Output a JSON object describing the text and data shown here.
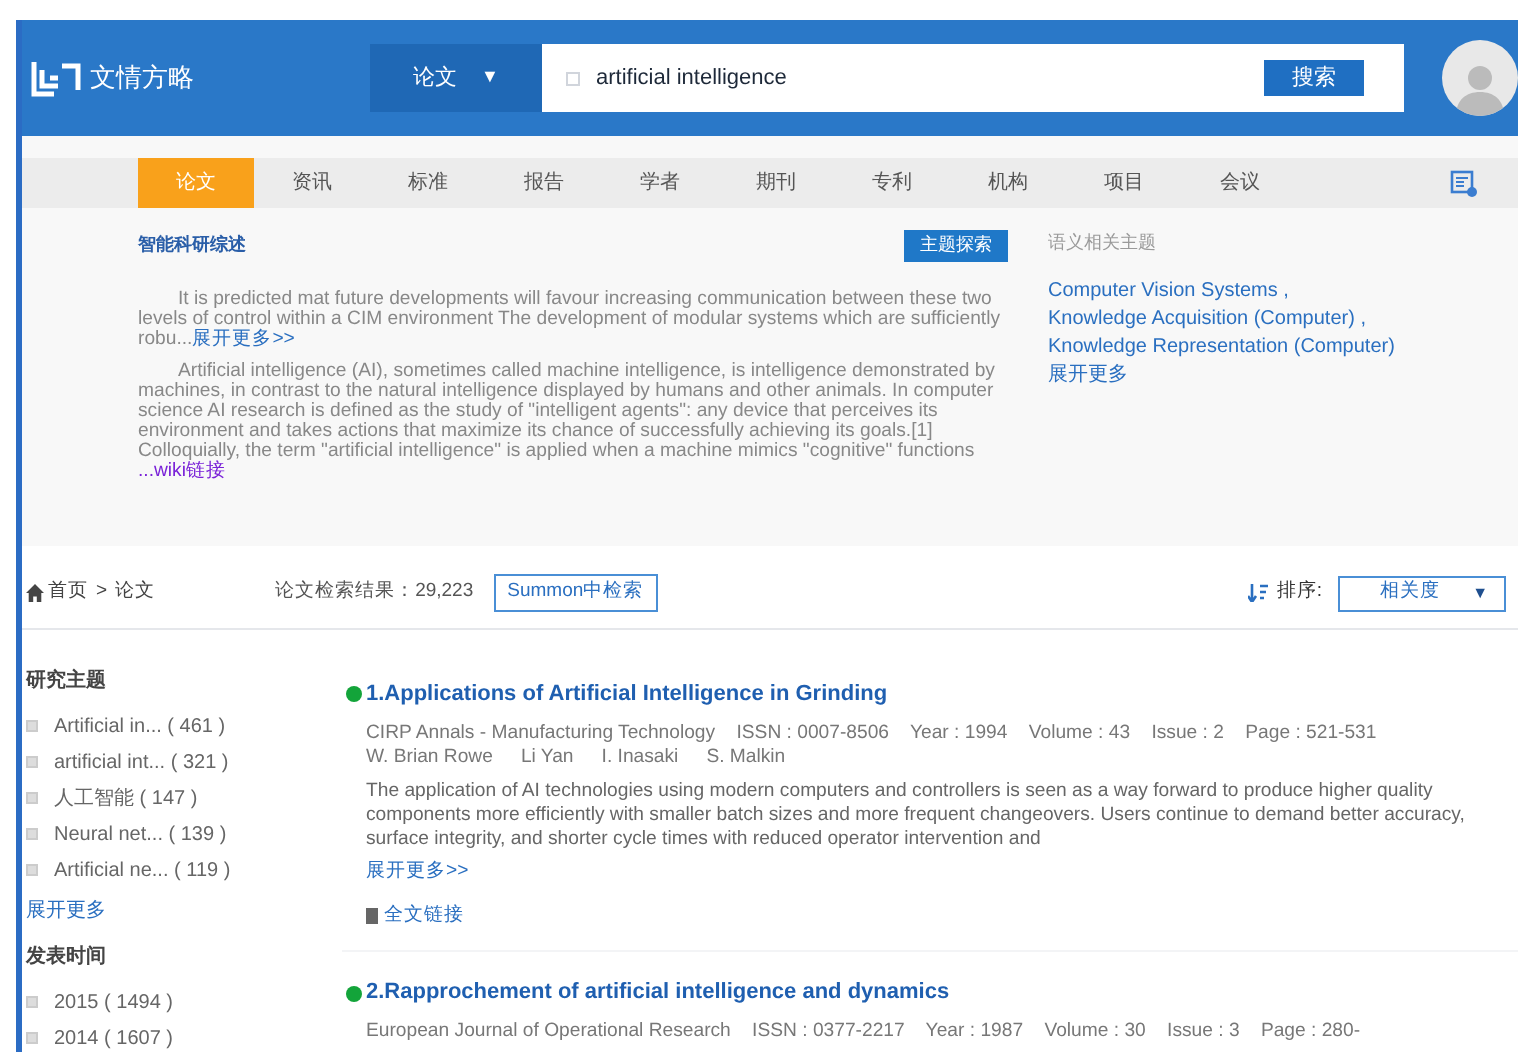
{
  "header": {
    "logo_text": "文情方略",
    "search": {
      "type_label": "论文",
      "caret": "▼",
      "value": "artificial intelligence",
      "button": "搜索"
    }
  },
  "tabs": [
    {
      "label": "论文",
      "selected": true
    },
    {
      "label": "资讯",
      "selected": false
    },
    {
      "label": "标准",
      "selected": false
    },
    {
      "label": "报告",
      "selected": false
    },
    {
      "label": "学者",
      "selected": false
    },
    {
      "label": "期刊",
      "selected": false
    },
    {
      "label": "专利",
      "selected": false
    },
    {
      "label": "机构",
      "selected": false
    },
    {
      "label": "项目",
      "selected": false
    },
    {
      "label": "会议",
      "selected": false
    }
  ],
  "summary": {
    "title": "智能科研综述",
    "button": "主题探索",
    "paragraphs": [
      {
        "text": "It is predicted mat future developments will favour increasing communication between these two levels of control within a CIM environment The development of modular systems which are sufficiently robu...",
        "link": "展开更多>>"
      },
      {
        "text": "Artificial intelligence (AI), sometimes called machine intelligence, is intelligence demonstrated by machines, in contrast to the natural intelligence displayed by humans and other animals. In computer science AI research is defined as the study of \"intelligent agents\": any device that perceives its environment and takes actions that maximize its chance of successfully achieving its goals.[1] Colloquially, the term \"artificial intelligence\" is applied when a machine mimics \"cognitive\" functions ",
        "link": "...wiki链接"
      }
    ],
    "related": {
      "title": "语义相关主题",
      "items": [
        "Computer Vision Systems ,",
        "Knowledge Acquisition (Computer) ,",
        "Knowledge Representation (Computer)"
      ],
      "more": "展开更多"
    }
  },
  "breadcrumb": {
    "home": "首页",
    "separator": ">",
    "current": "论文"
  },
  "result_count": "论文检索结果：29,223",
  "summon_button": "Summon中检索",
  "sort": {
    "label": "排序:",
    "value": "相关度",
    "caret": "▼"
  },
  "facets": [
    {
      "title": "研究主题",
      "items": [
        {
          "label": "Artificial in...",
          "count": "( 461 )",
          "checked": false
        },
        {
          "label": "artificial int...",
          "count": "( 321 )",
          "checked": false
        },
        {
          "label": "人工智能",
          "count": "( 147 )",
          "checked": false
        },
        {
          "label": "Neural net...",
          "count": "( 139 )",
          "checked": false
        },
        {
          "label": "Artificial ne...",
          "count": "( 119 )",
          "checked": false
        }
      ],
      "more": "展开更多"
    },
    {
      "title": "发表时间",
      "items": [
        {
          "label": "2015",
          "count": "( 1494 )",
          "checked": false
        },
        {
          "label": "2014",
          "count": "( 1607 )",
          "checked": false
        }
      ]
    }
  ],
  "results": [
    {
      "title": "1.Applications of Artificial Intelligence in Grinding",
      "meta": "CIRP Annals - Manufacturing Technology    ISSN : 0007-8506    Year : 1994    Volume : 43    Issue : 2    Page : 521-531",
      "authors": [
        "W. Brian Rowe",
        "Li Yan",
        "I. Inasaki",
        "S. Malkin"
      ],
      "abstract": "The application of AI technologies using modern computers and controllers is seen as a way forward to produce higher quality components more efficiently with smaller batch sizes and more frequent changeovers. Users continue to demand better accuracy, surface integrity, and shorter cycle times with reduced operator intervention and",
      "more": "展开更多>>",
      "fulltext": "全文链接"
    },
    {
      "title": "2.Rapprochement of artificial intelligence and dynamics",
      "meta": "European Journal of Operational Research    ISSN : 0377-2217    Year : 1987    Volume : 30    Issue : 3    Page : 280-"
    }
  ]
}
